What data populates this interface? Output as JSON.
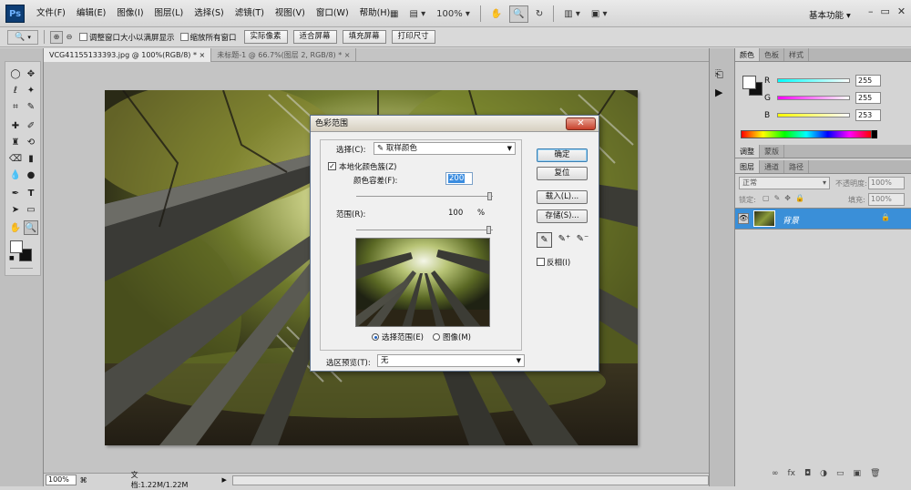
{
  "app": {
    "logo": "Ps",
    "workspace": "基本功能 ▾"
  },
  "menus": [
    "文件(F)",
    "编辑(E)",
    "图像(I)",
    "图层(L)",
    "选择(S)",
    "滤镜(T)",
    "视图(V)",
    "窗口(W)",
    "帮助(H)"
  ],
  "menubar_zoom": "100%",
  "options": {
    "chk1_label": "调整窗口大小以满屏显示",
    "chk2_label": "缩放所有窗口",
    "btn_actual": "实际像素",
    "btn_fit": "适合屏幕",
    "btn_fill": "填充屏幕",
    "btn_print": "打印尺寸"
  },
  "tabs": [
    {
      "label": "VCG41155133393.jpg @ 100%(RGB/8) *",
      "close": "×"
    },
    {
      "label": "未标题-1 @ 66.7%(图层 2, RGB/8) *",
      "close": "×"
    }
  ],
  "status": {
    "zoom": "100%",
    "doc": "文档:1.22M/1.22M"
  },
  "color_panel": {
    "tabs": [
      "颜色",
      "色板",
      "样式"
    ],
    "r_label": "R",
    "g_label": "G",
    "b_label": "B",
    "r": "255",
    "g": "255",
    "b": "253"
  },
  "adjust_tabs": [
    "调整",
    "蒙版"
  ],
  "layers_panel": {
    "tabs": [
      "图层",
      "通道",
      "路径"
    ],
    "blend": "正常",
    "opacity_label": "不透明度:",
    "opacity": "100%",
    "lock_label": "锁定:",
    "fill_label": "填充:",
    "fill": "100%",
    "layer_name": "背景"
  },
  "dialog": {
    "title": "色彩范围",
    "select_label": "选择(C):",
    "select_value": "取样颜色",
    "localized_label": "本地化颜色簇(Z)",
    "localized_check": "✓",
    "fuzz_label": "颜色容差(F):",
    "fuzz_value": "200",
    "range_label": "范围(R):",
    "range_value": "100",
    "range_unit": "%",
    "radio_sel": "选择范围(E)",
    "radio_img": "图像(M)",
    "preview_label": "选区预览(T):",
    "preview_value": "无",
    "btn_ok": "确定",
    "btn_reset": "复位",
    "btn_load": "载入(L)...",
    "btn_save": "存储(S)...",
    "invert_label": "反相(I)"
  },
  "colors": {
    "accent": "#3b8de0",
    "selected_layer": "#3a8fd8"
  }
}
